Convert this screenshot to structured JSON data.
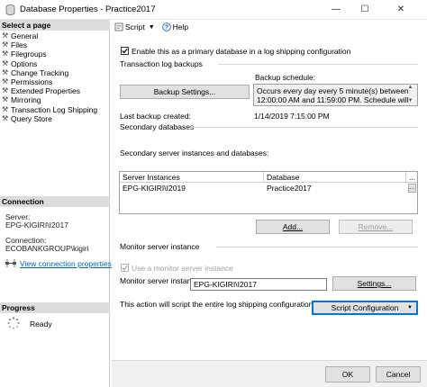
{
  "window": {
    "title": "Database Properties - Practice2017",
    "minimize": "—",
    "maximize": "☐",
    "close": "✕"
  },
  "left_pane": {
    "select_page_header": "Select a page",
    "pages": [
      {
        "label": "General",
        "icon": "wrench-icon"
      },
      {
        "label": "Files",
        "icon": "wrench-icon"
      },
      {
        "label": "Filegroups",
        "icon": "wrench-icon"
      },
      {
        "label": "Options",
        "icon": "wrench-icon"
      },
      {
        "label": "Change Tracking",
        "icon": "wrench-icon"
      },
      {
        "label": "Permissions",
        "icon": "wrench-icon"
      },
      {
        "label": "Extended Properties",
        "icon": "wrench-icon"
      },
      {
        "label": "Mirroring",
        "icon": "wrench-icon"
      },
      {
        "label": "Transaction Log Shipping",
        "icon": "wrench-icon",
        "selected": true
      },
      {
        "label": "Query Store",
        "icon": "wrench-icon"
      }
    ],
    "connection_header": "Connection",
    "server_label": "Server:",
    "server_value": "EPG-KIGIRI\\I2017",
    "connection_label": "Connection:",
    "connection_value": "ECOBANKGROUP\\kigiri",
    "view_connection_properties": "View connection properties",
    "progress_header": "Progress",
    "progress_status": "Ready"
  },
  "toolbar": {
    "script_label": "Script",
    "help_label": "Help"
  },
  "main": {
    "enable_primary_label": "Enable this as a primary database in a log shipping configuration",
    "enable_primary_checked": true,
    "transaction_log_backups": "Transaction log backups",
    "backup_schedule_label": "Backup schedule:",
    "backup_settings_button": "Backup Settings...",
    "backup_schedule_text": "Occurs every day every 5 minute(s) between 12:00:00 AM and 11:59:00 PM. Schedule will be",
    "last_backup_created_label": "Last backup created:",
    "last_backup_created_value": "1/14/2019 7:15:00 PM",
    "secondary_databases": "Secondary databases",
    "secondary_instances_label": "Secondary server instances and databases:",
    "grid": {
      "columns": [
        "Server Instances",
        "Database",
        "..."
      ],
      "rows": [
        {
          "server": "EPG-KIGIRI\\I2019",
          "database": "Practice2017"
        }
      ]
    },
    "add_button": "Add...",
    "remove_button": "Remove...",
    "monitor_server_instance": "Monitor server instance",
    "use_monitor_label": "Use a monitor server instance",
    "use_monitor_checked": true,
    "monitor_server_instance_label": "Monitor server instance",
    "monitor_server_value": "EPG-KIGIRI\\I2017",
    "settings_button": "Settings...",
    "script_note": "This action will script the entire log shipping configuration.",
    "script_configuration_button": "Script Configuration"
  },
  "footer": {
    "ok_button": "OK",
    "cancel_button": "Cancel"
  },
  "colors": {
    "accent": "#0078d7",
    "link": "#0066cc",
    "header_bg": "#dcdcdc"
  }
}
